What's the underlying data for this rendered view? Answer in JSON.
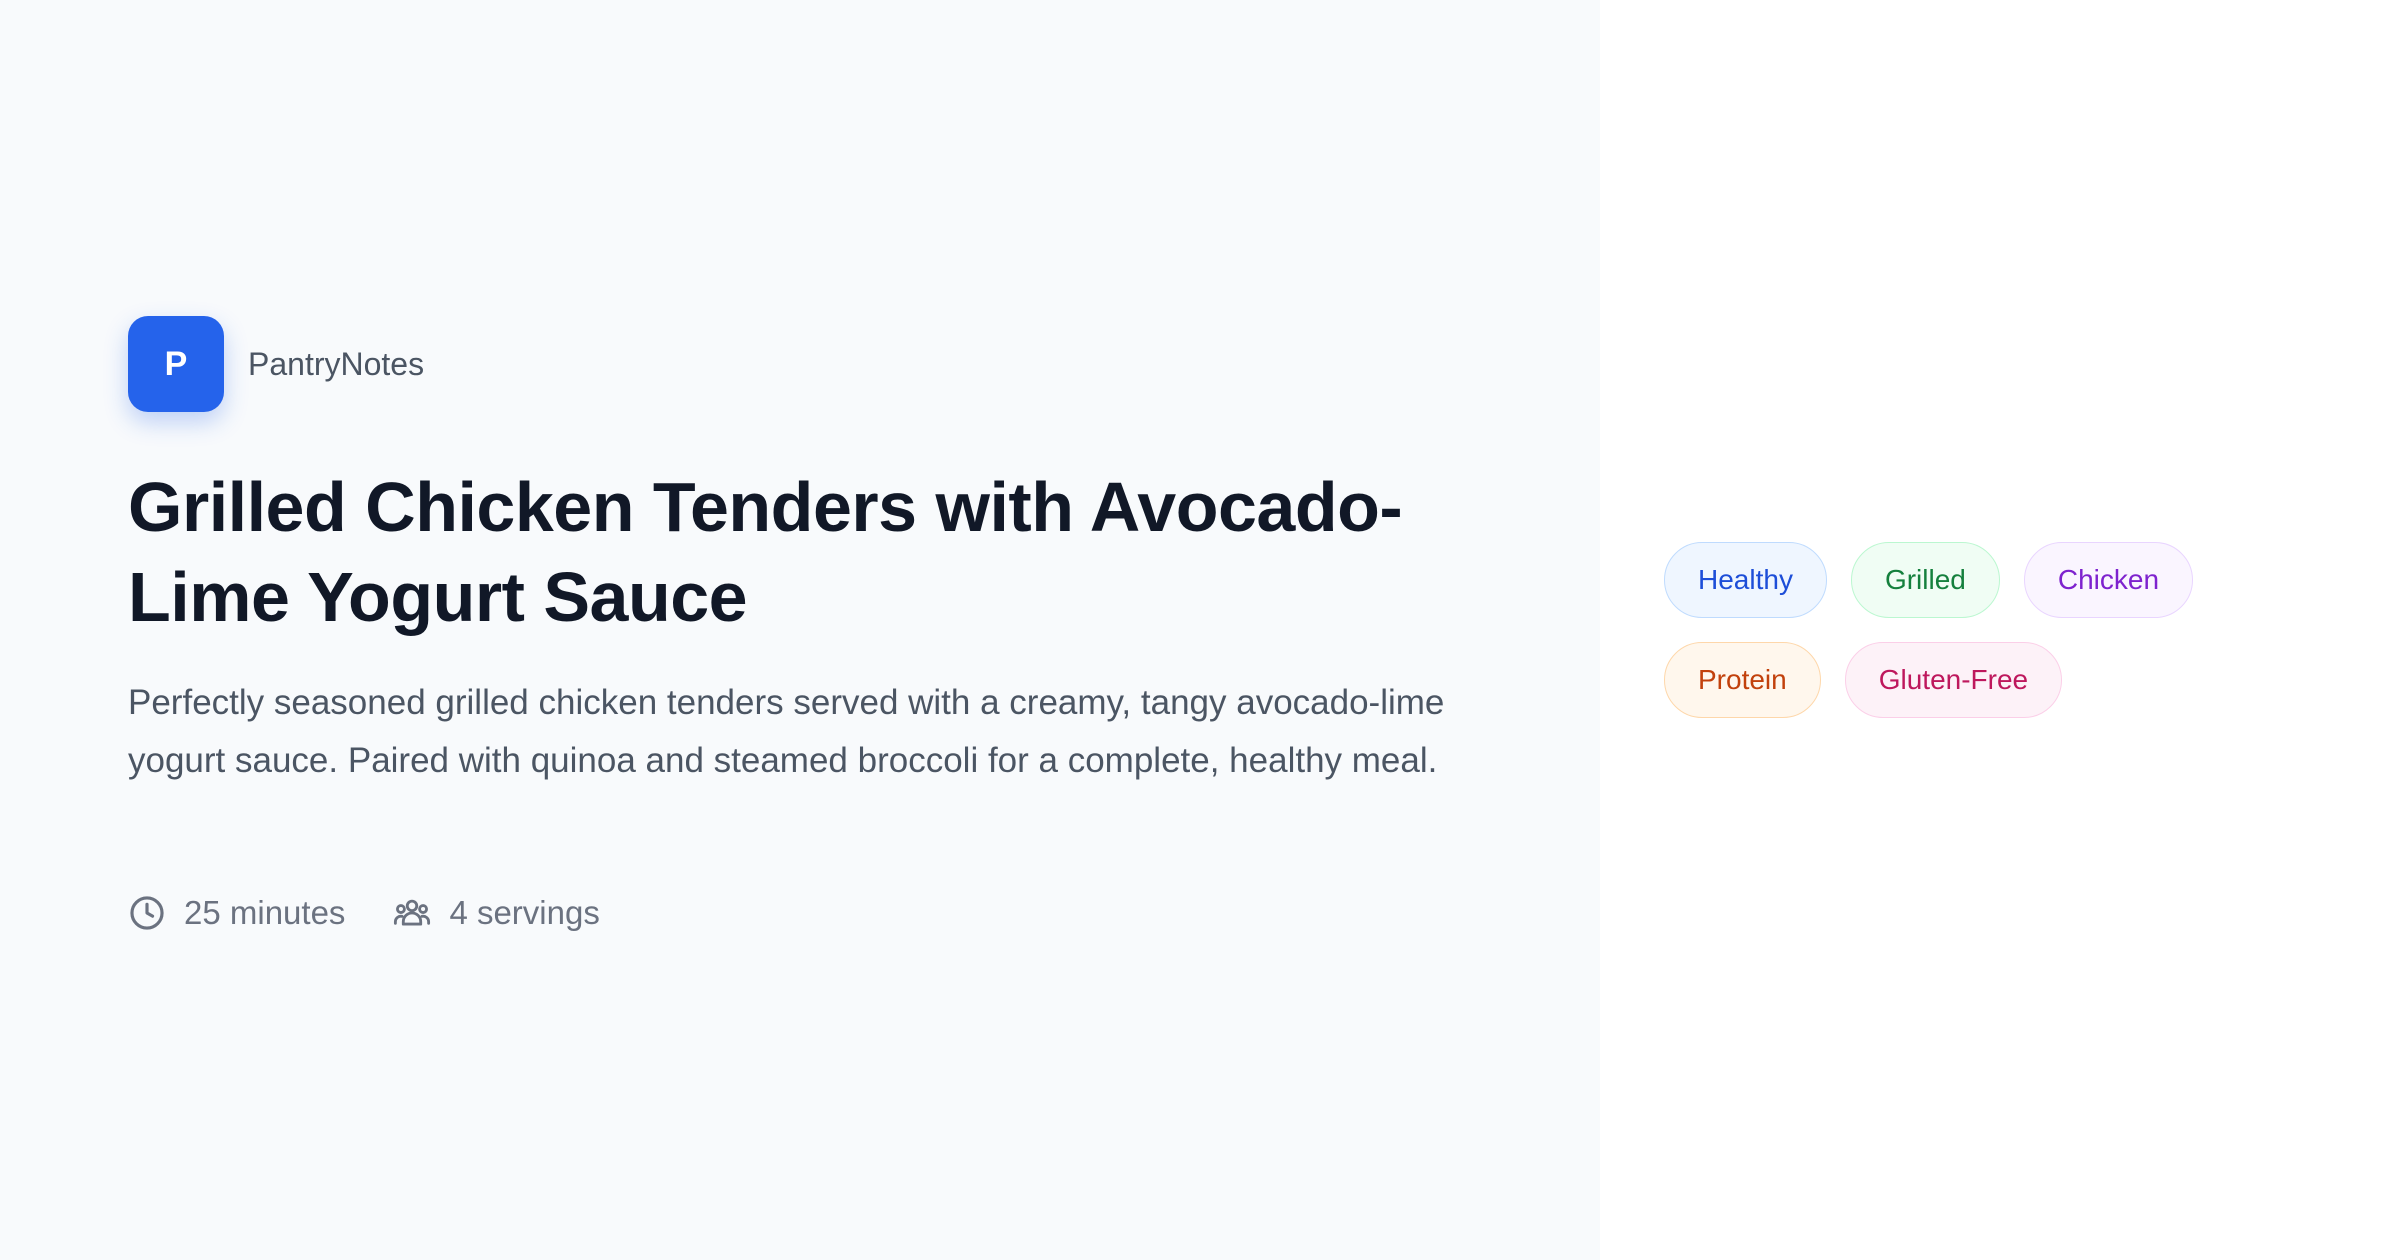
{
  "brand": {
    "logo_letter": "P",
    "name": "PantryNotes",
    "accent_color": "#2563eb"
  },
  "recipe": {
    "title": "Grilled Chicken Tenders with Avocado-Lime Yogurt Sauce",
    "description": "Perfectly seasoned grilled chicken tenders served with a creamy, tangy avocado-lime yogurt sauce. Paired with quinoa and steamed broccoli for a complete, healthy meal.",
    "time": {
      "icon": "clock-icon",
      "label": "25 minutes"
    },
    "servings": {
      "icon": "users-icon",
      "label": "4 servings"
    }
  },
  "tags": [
    {
      "label": "Healthy",
      "text_color": "#1d4ed8",
      "bg_color": "#eff6ff"
    },
    {
      "label": "Grilled",
      "text_color": "#15803d",
      "bg_color": "#f0fdf4"
    },
    {
      "label": "Chicken",
      "text_color": "#7e22ce",
      "bg_color": "#faf5ff"
    },
    {
      "label": "Protein",
      "text_color": "#c2410c",
      "bg_color": "#fff7ed"
    },
    {
      "label": "Gluten-Free",
      "text_color": "#be185d",
      "bg_color": "#fdf2f8"
    }
  ]
}
